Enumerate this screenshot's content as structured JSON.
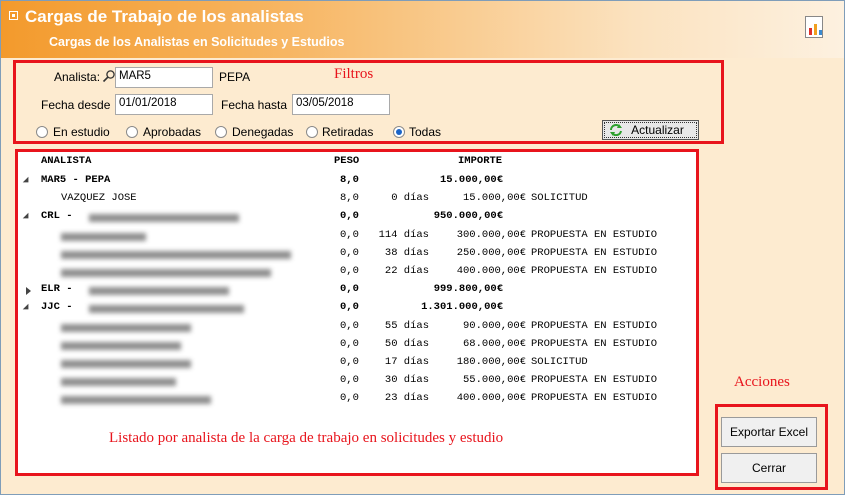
{
  "header": {
    "title": "Cargas de Trabajo de los analistas",
    "subtitle": "Cargas de los Analistas en Solicitudes y Estudios"
  },
  "annotations": {
    "filtros": "Filtros",
    "acciones": "Acciones",
    "listado": "Listado por analista de la carga de trabajo en solicitudes y estudio"
  },
  "filters": {
    "analista_label": "Analista:",
    "analista_code": "MAR5",
    "analista_name": "PEPA",
    "fecha_desde_label": "Fecha desde",
    "fecha_desde": "01/01/2018",
    "fecha_hasta_label": "Fecha hasta",
    "fecha_hasta": "03/05/2018",
    "radios": [
      {
        "label": "En estudio",
        "selected": false
      },
      {
        "label": "Aprobadas",
        "selected": false
      },
      {
        "label": "Denegadas",
        "selected": false
      },
      {
        "label": "Retiradas",
        "selected": false
      },
      {
        "label": "Todas",
        "selected": true
      }
    ],
    "actualizar_label": "Actualizar"
  },
  "table": {
    "headers": {
      "analista": "ANALISTA",
      "peso": "PESO",
      "importe": "IMPORTE"
    },
    "rows": [
      {
        "type": "group",
        "expanded": true,
        "name": "MAR5 - PEPA",
        "peso": "8,0",
        "importe": "15.000,00€",
        "dias": "",
        "estado": ""
      },
      {
        "type": "item",
        "name": "VAZQUEZ JOSE",
        "peso": "8,0",
        "dias": "0 días",
        "importe": "15.000,00€",
        "estado": "SOLICITUD"
      },
      {
        "type": "group",
        "expanded": true,
        "name": "CRL - ",
        "peso": "0,0",
        "importe": "950.000,00€",
        "dias": "",
        "estado": ""
      },
      {
        "type": "item",
        "name": "",
        "peso": "0,0",
        "dias": "114 días",
        "importe": "300.000,00€",
        "estado": "PROPUESTA EN ESTUDIO"
      },
      {
        "type": "item",
        "name": "",
        "peso": "0,0",
        "dias": "38 días",
        "importe": "250.000,00€",
        "estado": "PROPUESTA EN ESTUDIO"
      },
      {
        "type": "item",
        "name": "",
        "peso": "0,0",
        "dias": "22 días",
        "importe": "400.000,00€",
        "estado": "PROPUESTA EN ESTUDIO"
      },
      {
        "type": "group",
        "expanded": false,
        "name": "ELR - ",
        "peso": "0,0",
        "importe": "999.800,00€",
        "dias": "",
        "estado": ""
      },
      {
        "type": "group",
        "expanded": true,
        "name": "JJC - ",
        "peso": "0,0",
        "importe": "1.301.000,00€",
        "dias": "",
        "estado": ""
      },
      {
        "type": "item",
        "name": "",
        "peso": "0,0",
        "dias": "55 días",
        "importe": "90.000,00€",
        "estado": "PROPUESTA EN ESTUDIO"
      },
      {
        "type": "item",
        "name": "",
        "peso": "0,0",
        "dias": "50 días",
        "importe": "68.000,00€",
        "estado": "PROPUESTA EN ESTUDIO"
      },
      {
        "type": "item",
        "name": "",
        "peso": "0,0",
        "dias": "17 días",
        "importe": "180.000,00€",
        "estado": "SOLICITUD"
      },
      {
        "type": "item",
        "name": "",
        "peso": "0,0",
        "dias": "30 días",
        "importe": "55.000,00€",
        "estado": "PROPUESTA EN ESTUDIO"
      },
      {
        "type": "item",
        "name": "",
        "peso": "0,0",
        "dias": "23 días",
        "importe": "400.000,00€",
        "estado": "PROPUESTA EN ESTUDIO"
      }
    ]
  },
  "actions": {
    "exportar_label": "Exportar Excel",
    "cerrar_label": "Cerrar"
  }
}
